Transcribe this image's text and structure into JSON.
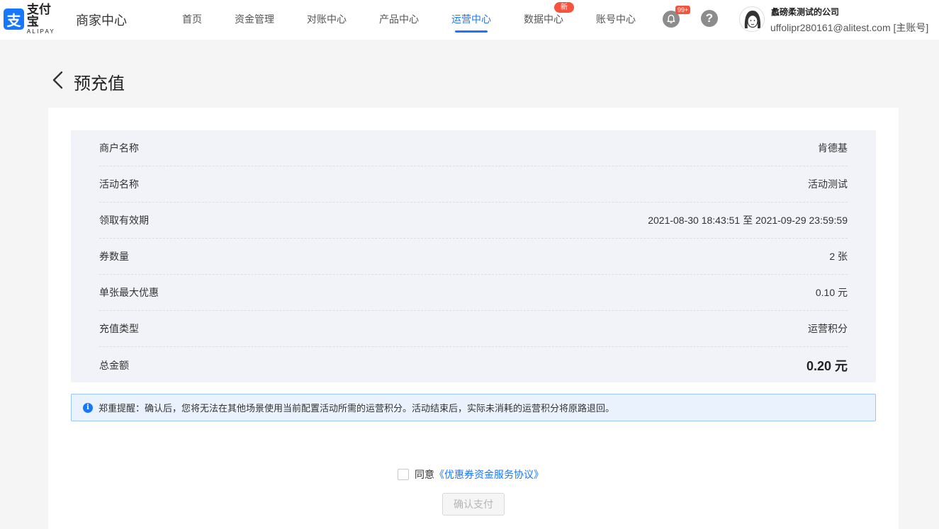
{
  "header": {
    "logo_cn": "支付宝",
    "logo_en": "ALIPAY",
    "app_title": "商家中心",
    "nav": [
      "首页",
      "资金管理",
      "对账中心",
      "产品中心",
      "运营中心",
      "数据中心",
      "账号中心"
    ],
    "active_nav": "运营中心",
    "new_badge": "新",
    "notification_count": "99+",
    "help": "?",
    "company": "蠡磅柔测试的公司",
    "account": "uffolipr280161@alitest.com [主账号]"
  },
  "page": {
    "title": "预充值"
  },
  "details": [
    {
      "label": "商户名称",
      "value": "肯德基"
    },
    {
      "label": "活动名称",
      "value": "活动测试"
    },
    {
      "label": "领取有效期",
      "value": "2021-08-30 18:43:51 至 2021-09-29 23:59:59"
    },
    {
      "label": "券数量",
      "value": "2 张"
    },
    {
      "label": "单张最大优惠",
      "value": "0.10 元"
    },
    {
      "label": "充值类型",
      "value": "运营积分"
    },
    {
      "label": "总金额",
      "value": "0.20 元"
    }
  ],
  "notice": {
    "icon": "i",
    "text": "郑重提醒：确认后，您将无法在其他场景使用当前配置活动所需的运营积分。活动结束后，实际未消耗的运营积分将原路退回。"
  },
  "agreement": {
    "prefix": "同意",
    "link": "《优惠券资金服务协议》",
    "checked": false
  },
  "confirm_button": "确认支付",
  "colors": {
    "accent": "#1677ff",
    "badge": "#f5533d",
    "info_bg": "#f2f3f8",
    "notice_bg": "#eaf3fd"
  }
}
